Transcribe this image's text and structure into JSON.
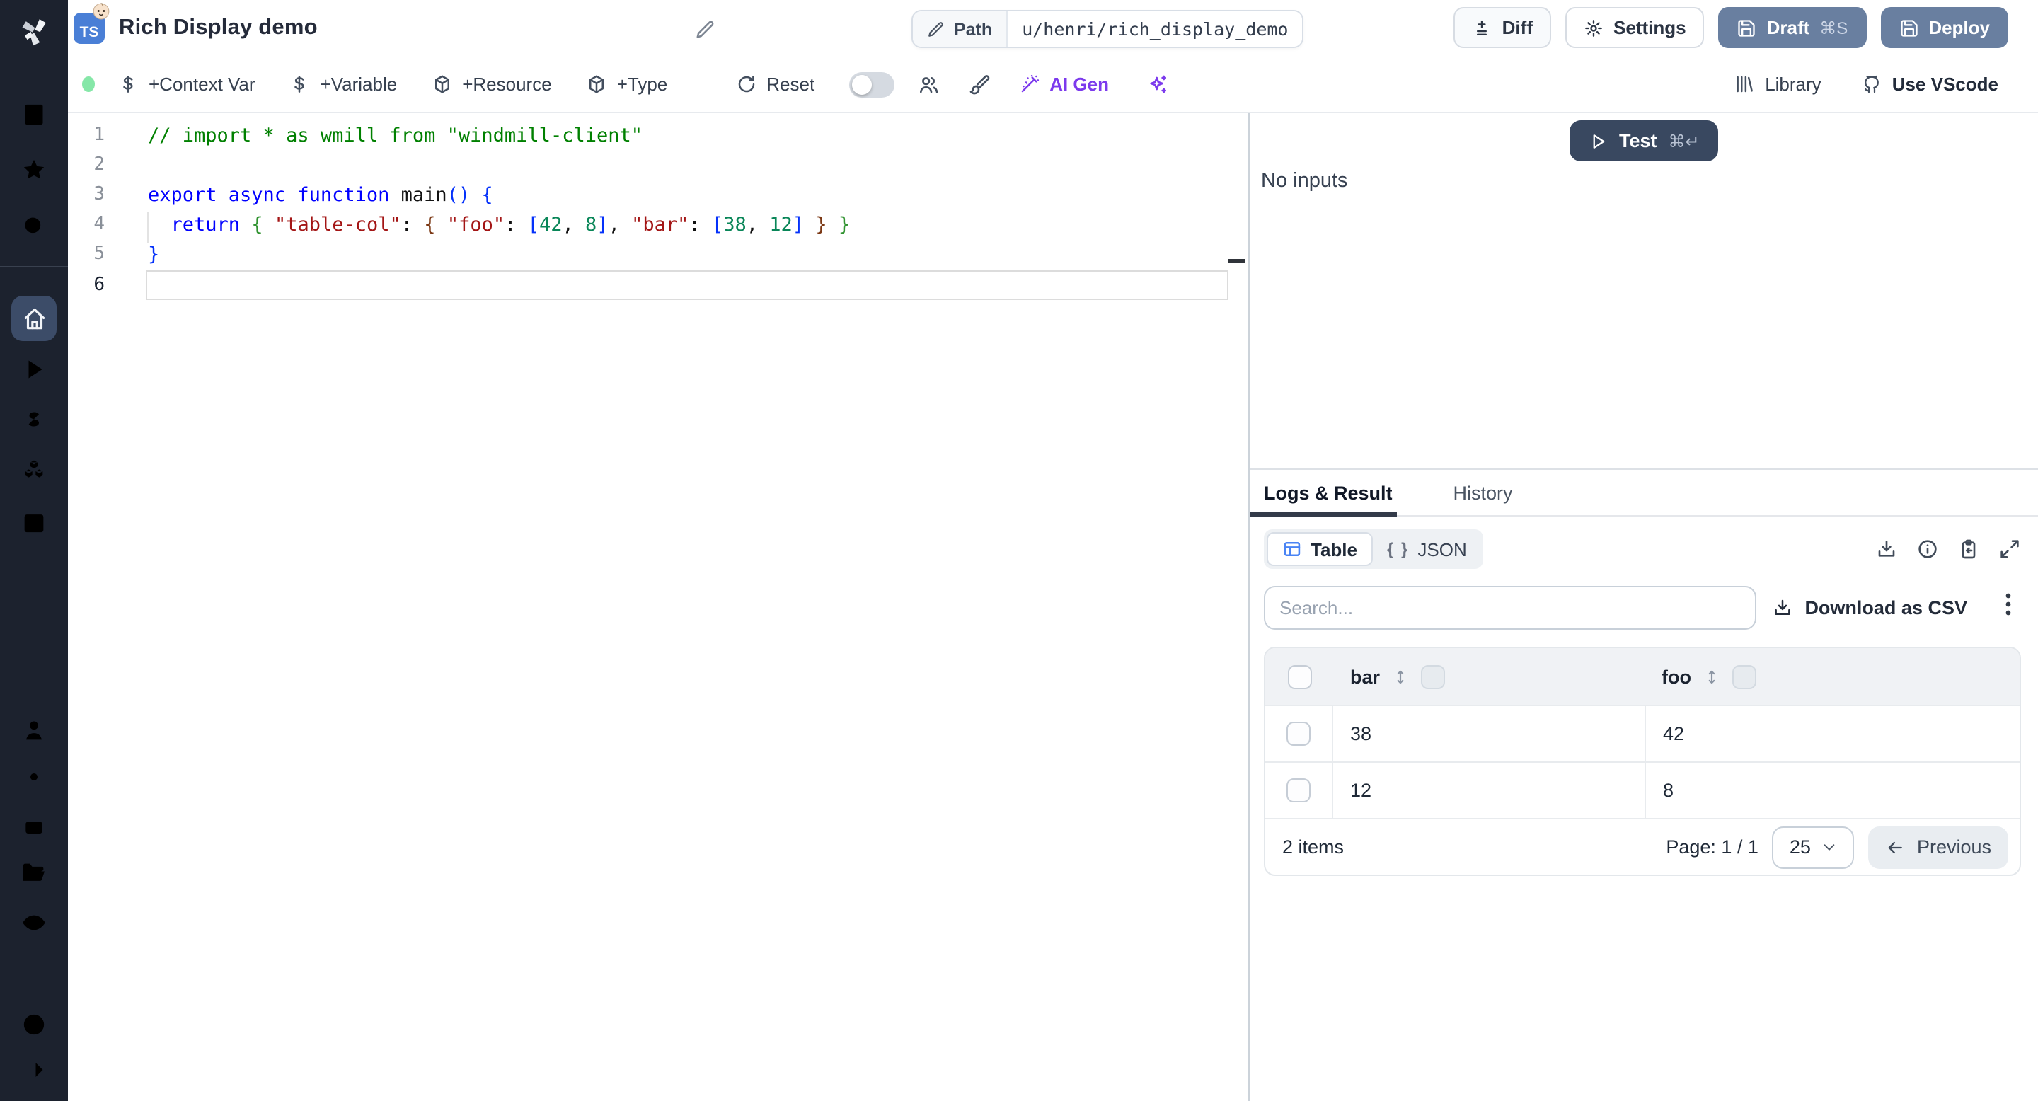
{
  "colors": {
    "primary_button": "#697fa0",
    "test_button": "#394860",
    "ai_accent": "#7c3aed",
    "ts_badge": "#4a7fd6",
    "status_dot": "#86e7a8"
  },
  "topbar": {
    "language_badge": "TS",
    "title": "Rich Display demo",
    "path_label": "Path",
    "path_value": "u/henri/rich_display_demo",
    "actions": {
      "diff": "Diff",
      "settings": "Settings",
      "draft": "Draft",
      "draft_kbd": "⌘S",
      "deploy": "Deploy"
    }
  },
  "toolbar": {
    "context_var": "+Context Var",
    "variable": "+Variable",
    "resource": "+Resource",
    "type": "+Type",
    "reset": "Reset",
    "ai_gen": "AI Gen",
    "library": "Library",
    "use_vscode": "Use VScode"
  },
  "editor": {
    "active_line": 6,
    "lines": [
      [
        {
          "t": "// import * as wmill from \"windmill-client\"",
          "s": "comment"
        }
      ],
      [],
      [
        {
          "t": "export async function ",
          "s": "kw"
        },
        {
          "t": "main",
          "s": "fn"
        },
        {
          "t": "() {",
          "s": "b1"
        }
      ],
      [
        {
          "t": "  ",
          "s": "pl"
        },
        {
          "t": "return",
          "s": "kw"
        },
        {
          "t": " ",
          "s": "pl"
        },
        {
          "t": "{",
          "s": "b2"
        },
        {
          "t": " ",
          "s": "pl"
        },
        {
          "t": "\"table-col\"",
          "s": "str"
        },
        {
          "t": ": ",
          "s": "pl"
        },
        {
          "t": "{",
          "s": "b3"
        },
        {
          "t": " ",
          "s": "pl"
        },
        {
          "t": "\"foo\"",
          "s": "str"
        },
        {
          "t": ": ",
          "s": "pl"
        },
        {
          "t": "[",
          "s": "b1"
        },
        {
          "t": "42",
          "s": "num"
        },
        {
          "t": ", ",
          "s": "pl"
        },
        {
          "t": "8",
          "s": "num"
        },
        {
          "t": "]",
          "s": "b1"
        },
        {
          "t": ", ",
          "s": "pl"
        },
        {
          "t": "\"bar\"",
          "s": "str"
        },
        {
          "t": ": ",
          "s": "pl"
        },
        {
          "t": "[",
          "s": "b1"
        },
        {
          "t": "38",
          "s": "num"
        },
        {
          "t": ", ",
          "s": "pl"
        },
        {
          "t": "12",
          "s": "num"
        },
        {
          "t": "]",
          "s": "b1"
        },
        {
          "t": " ",
          "s": "pl"
        },
        {
          "t": "}",
          "s": "b3"
        },
        {
          "t": " ",
          "s": "pl"
        },
        {
          "t": "}",
          "s": "b2"
        }
      ],
      [
        {
          "t": "}",
          "s": "b1"
        }
      ],
      []
    ]
  },
  "panel": {
    "test_label": "Test",
    "test_kbd": "⌘↵",
    "no_inputs": "No inputs",
    "tabs": {
      "logs": "Logs & Result",
      "history": "History"
    },
    "views": {
      "table": "Table",
      "json": "JSON",
      "json_glyph": "{ }"
    },
    "search_placeholder": "Search...",
    "download_csv": "Download as CSV",
    "table": {
      "columns": [
        "bar",
        "foo"
      ],
      "rows": [
        [
          "38",
          "42"
        ],
        [
          "12",
          "8"
        ]
      ],
      "summary": "2 items",
      "page": "Page: 1 / 1",
      "page_size": "25",
      "previous": "Previous"
    }
  }
}
